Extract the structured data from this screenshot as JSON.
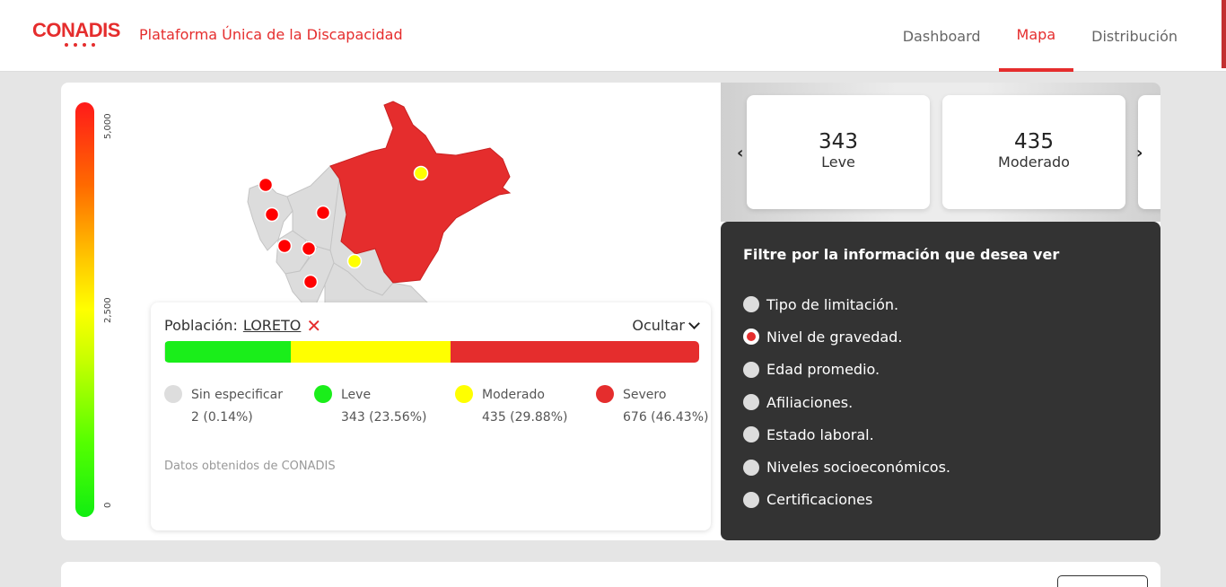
{
  "header": {
    "logo_text": "CONADIS",
    "platform_title": "Plataforma Única de la Discapacidad",
    "nav": [
      {
        "label": "Dashboard",
        "active": false
      },
      {
        "label": "Mapa",
        "active": true
      },
      {
        "label": "Distribución",
        "active": false
      }
    ]
  },
  "scale": {
    "max_label": "5,000",
    "mid_label": "2,500",
    "min_label": "0"
  },
  "legend": {
    "population_label": "Población:",
    "population_value": "LORETO",
    "hide_label": "Ocultar",
    "bar_fractions": {
      "sin_especificar": 0.0014,
      "leve": 0.2356,
      "moderado": 0.2988,
      "severo": 0.4643
    },
    "items": [
      {
        "name": "Sin especificar",
        "count": "2 (0.14%)",
        "color": "#dddddd"
      },
      {
        "name": "Leve",
        "count": "343 (23.56%)",
        "color": "#1aee1a"
      },
      {
        "name": "Moderado",
        "count": "435 (29.88%)",
        "color": "#ffff00"
      },
      {
        "name": "Severo",
        "count": "676 (46.43%)",
        "color": "#e52d2d"
      }
    ],
    "source": "Datos obtenidos de CONADIS"
  },
  "carousel": {
    "prev_icon": "chevron-left-icon",
    "next_icon": "chevron-right-icon",
    "cards": [
      {
        "value": "343",
        "label": "Leve"
      },
      {
        "value": "435",
        "label": "Moderado"
      }
    ]
  },
  "filter": {
    "title": "Filtre por la información que desea ver",
    "options": [
      {
        "label": "Tipo de limitación.",
        "checked": false
      },
      {
        "label": "Nivel de gravedad.",
        "checked": true
      },
      {
        "label": "Edad promedio.",
        "checked": false
      },
      {
        "label": "Afiliaciones.",
        "checked": false
      },
      {
        "label": "Estado laboral.",
        "checked": false
      },
      {
        "label": "Niveles socioeconómicos.",
        "checked": false
      },
      {
        "label": "Certificaciones",
        "checked": false
      }
    ]
  },
  "colors": {
    "accent": "#e52d2d",
    "filter_bg": "#333333",
    "leve": "#1aee1a",
    "moderado": "#ffff00",
    "severo": "#e52d2d",
    "sin_especificar": "#dddddd"
  }
}
